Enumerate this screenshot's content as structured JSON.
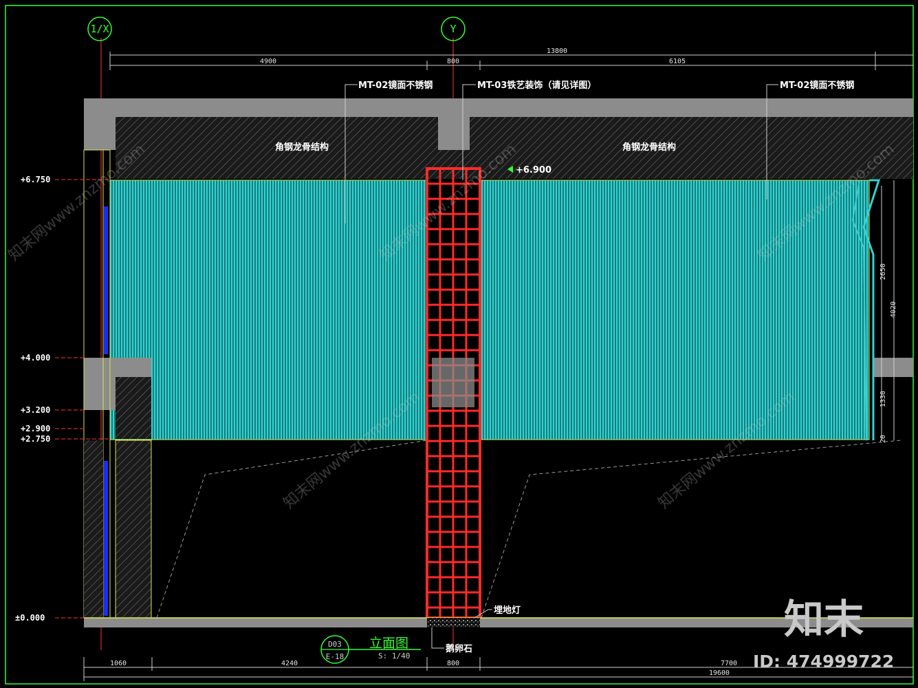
{
  "grid_axes": [
    {
      "label": "1/X"
    },
    {
      "label": "Y"
    }
  ],
  "top_dimensions": {
    "overall": "13800",
    "segments": [
      "4900",
      "800",
      "6105"
    ]
  },
  "bottom_dimensions": {
    "segments": [
      "1060",
      "4240",
      "800",
      "7700"
    ],
    "overall": "19600"
  },
  "levels": [
    "+6.750",
    "+4.000",
    "+3.200",
    "+2.900",
    "+2.750",
    "±0.000"
  ],
  "callouts": {
    "mt02_left": "MT-02镜面不锈钢",
    "mt03": "MT-03铁艺装饰（请见详图）",
    "mt02_right": "MT-02镜面不锈钢",
    "steel_left": "角钢龙骨结构",
    "steel_right": "角钢龙骨结构",
    "level_marker": "+6.900",
    "floor_light": "埋地灯",
    "pebbles": "鹅卵石"
  },
  "right_dimensions": [
    "2650",
    "4020",
    "1330",
    "20"
  ],
  "title_block": {
    "code_top": "D03",
    "code_bottom": "E-18",
    "title": "立面图",
    "scale": "S: 1/40"
  },
  "watermark": {
    "logo": "知末",
    "id_text": "ID: 474999722",
    "repeat_text": "知末网www.znzmo.com"
  },
  "colors": {
    "background": "#000000",
    "panel": "#25bcbc",
    "screen": "#ff2a2a",
    "structure": "#8c8c8c",
    "frame": "#33ff33",
    "accent_blue": "#1a2cff"
  }
}
